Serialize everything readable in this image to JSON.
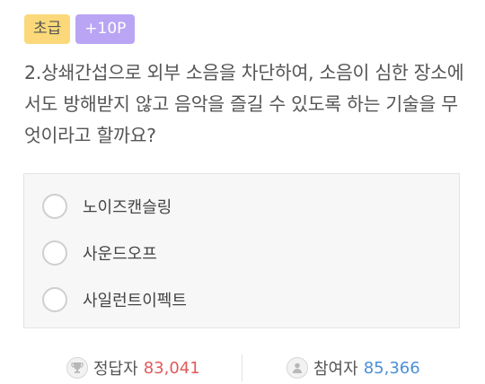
{
  "badges": {
    "level": "초급",
    "points": "+10P"
  },
  "question": "2.상쇄간섭으로 외부 소음을 차단하여, 소음이 심한 장소에서도 방해받지 않고 음악을 즐길 수 있도록 하는 기술을 무엇이라고 할까요?",
  "options": [
    {
      "label": "노이즈캔슬링"
    },
    {
      "label": "사운드오프"
    },
    {
      "label": "사일런트이펙트"
    }
  ],
  "stats": {
    "correct_label": "정답자",
    "correct_value": "83,041",
    "participants_label": "참여자",
    "participants_value": "85,366"
  },
  "colors": {
    "level_badge": "#fbd97a",
    "points_badge": "#b9a5f4",
    "correct_value": "#e05a5a",
    "participants_value": "#4a8fd6"
  },
  "icons": {
    "correct": "trophy-icon",
    "participants": "user-icon"
  }
}
